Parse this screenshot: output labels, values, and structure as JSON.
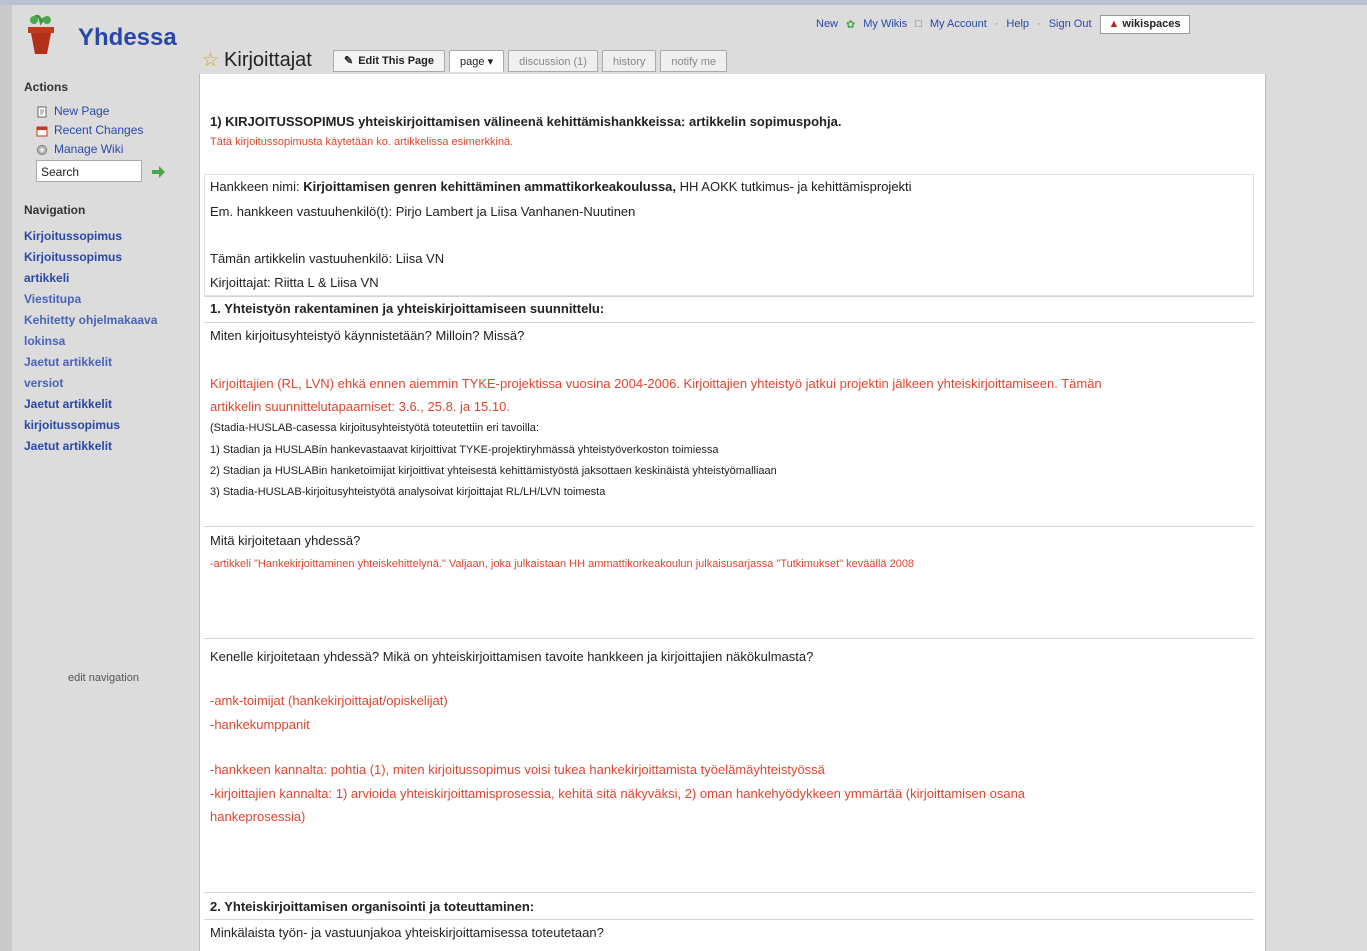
{
  "app": {
    "name": "Yhdessa"
  },
  "sidebar": {
    "actions_heading": "Actions",
    "actions": [
      {
        "label": "New Page",
        "icon": "new-page-icon"
      },
      {
        "label": "Recent Changes",
        "icon": "recent-changes-icon"
      },
      {
        "label": "Manage Wiki",
        "icon": "manage-wiki-icon"
      }
    ],
    "search_value": "Search",
    "navigation_heading": "Navigation",
    "nav_items": [
      "Kirjoitussopimus",
      "Kirjoitussopimus",
      "artikkeli",
      "Viestitupa",
      "Kehitetty ohjelmakaava",
      "lokinsa",
      "Jaetut artikkelit",
      "versiot",
      "Jaetut artikkelit",
      "kirjoitussopimus",
      "Jaetut artikkelit"
    ],
    "footer_text": "edit navigation"
  },
  "topnav": {
    "items": [
      "New",
      "My Wikis",
      "My Account",
      "Help",
      "Sign Out"
    ],
    "workspace_button": "wikispaces"
  },
  "page": {
    "title": "Kirjoittajat",
    "tabs": [
      {
        "label": "Edit This Page",
        "icon": "edit-icon"
      },
      {
        "label": "page"
      },
      {
        "label": "discussion (1)"
      },
      {
        "label": "history"
      },
      {
        "label": "notify me"
      }
    ]
  },
  "doc": {
    "heading": "1) KIRJOITUSSOPIMUS yhteiskirjoittamisen välineenä kehittämishankkeissa: artikkelin sopimuspohja.",
    "note": "Tätä kirjoitussopimusta käytetään ko. artikkelissa esimerkkinä.",
    "hanke_label": "Hankkeen nimi:",
    "hanke_name": "Kirjoittamisen genren kehittäminen ammattikorkeakoulussa,",
    "hanke_tail": "HH AOKK tutkimus- ja kehittämisprojekti",
    "vastuu_line": "Em. hankkeen vastuuhenkilö(t): Pirjo Lambert ja Liisa Vanhanen-Nuutinen",
    "artikkeli_vastuu": "Tämän artikkelin vastuuhenkilö: Liisa VN",
    "kirjoittajat": "Kirjoittajat: Riitta L & Liisa VN",
    "s1_title": "1. Yhteistyön rakentaminen ja yhteiskirjoittamiseen suunnittelu:",
    "q1": "Miten kirjoitusyhteistyö käynnistetään? Milloin? Missä?",
    "a1_line1": "Kirjoittajien (RL, LVN) ehkä ennen aiemmin TYKE-projektissa vuosina 2004-2006. Kirjoittajien yhteistyö jatkui projektin jälkeen yhteiskirjoittamiseen. Tämän",
    "a1_line2": "artikkelin suunnittelutapaamiset: 3.6., 25.8. ja 15.10.",
    "a1_intro": "(Stadia-HUSLAB-casessa kirjoitusyhteistyötä toteutettiin eri tavoilla:",
    "a1_list": [
      "1) Stadian ja HUSLABin hankevastaavat kirjoittivat TYKE-projektiryhmässä yhteistyöverkoston toimiessa",
      "2) Stadian ja HUSLABin hanketoimijat kirjoittivat yhteisestä kehittämistyöstä jaksottaen keskinäistä yhteistyömalliaan",
      "3) Stadia-HUSLAB-kirjoitusyhteistyötä analysoivat kirjoittajat RL/LH/LVN toimesta"
    ],
    "q2": "Mitä kirjoitetaan yhdessä?",
    "a2": "-artikkeli \"Hankekirjoittaminen yhteiskehittelynä.\" Valjaan, joka julkaistaan HH ammattikorkeakoulun julkaisusarjassa \"Tutkimukset\" keväällä 2008",
    "q3": "Kenelle kirjoitetaan yhdessä? Mikä on yhteiskirjoittamisen tavoite hankkeen ja kirjoittajien näkökulmasta?",
    "a3_1": "-amk-toimijat (hankekirjoittajat/opiskelijat)",
    "a3_2": "-hankekumppanit",
    "a3_3": "-hankkeen kannalta: pohtia (1), miten kirjoitussopimus voisi tukea hankekirjoittamista työelämäyhteistyössä",
    "a3_4": "-kirjoittajien kannalta: 1) arvioida yhteiskirjoittamisprosessia, kehitä sitä näkyväksi, 2) oman hankehyödykkeen ymmärtää (kirjoittamisen osana",
    "a3_5": "hankeprosessia)",
    "s2_title": "2. Yhteiskirjoittamisen organisointi ja toteuttaminen:",
    "q4": "Minkälaista työn- ja vastuunjakoa yhteiskirjoittamisessa toteutetaan?"
  },
  "colors": {
    "link": "#2a47a8",
    "accent_red": "#e0452f",
    "star": "#d8a700"
  }
}
